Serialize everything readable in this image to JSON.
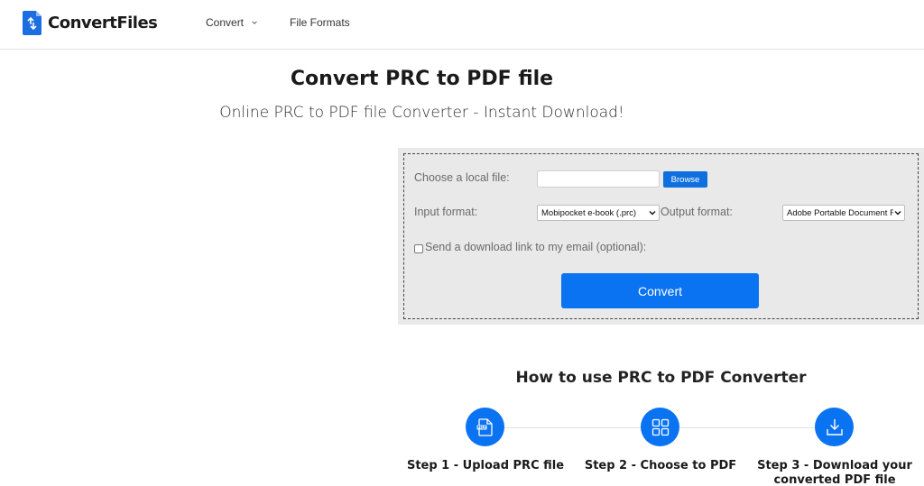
{
  "header": {
    "logo_text": "ConvertFiles",
    "nav": {
      "convert": "Convert",
      "file_formats": "File Formats"
    }
  },
  "main": {
    "title": "Convert PRC to PDF file",
    "subtitle": "Online PRC to PDF file Converter - Instant Download!"
  },
  "converter": {
    "choose_file_label": "Choose a local file:",
    "file_value": "",
    "browse_label": "Browse",
    "input_format_label": "Input format:",
    "input_format_value": "Mobipocket e-book (.prc)",
    "output_format_label": "Output format:",
    "output_format_value": "Adobe Portable Document Format (.pdf)",
    "email_label": "Send a download link to my email (optional):",
    "email_checked": false,
    "convert_label": "Convert"
  },
  "howto": {
    "title": "How to use PRC to PDF Converter",
    "steps": [
      {
        "label_line1": "Step 1 - Upload PRC file",
        "label_line2": "",
        "icon": "file-upload-icon"
      },
      {
        "label_line1": "Step 2 - Choose to PDF",
        "label_line2": "",
        "icon": "grid-icon"
      },
      {
        "label_line1": "Step 3 - Download your",
        "label_line2": "converted PDF file",
        "icon": "download-icon"
      }
    ]
  },
  "colors": {
    "accent": "#0a73f2",
    "panel_bg": "#e9e9e9",
    "logo_blue": "#1b6fe0"
  }
}
